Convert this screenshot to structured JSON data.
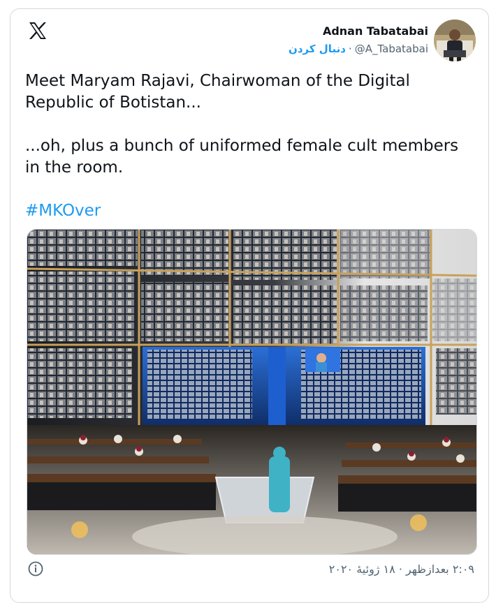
{
  "header": {
    "logo_icon": "x-logo-icon",
    "author_name": "Adnan Tabatabai",
    "follow_label": "دنبال کردن",
    "separator": "·",
    "handle": "@A_Tabatabai"
  },
  "tweet": {
    "line1": "Meet Maryam Rajavi, Chairwoman of the Digital Republic of Botistan...",
    "line2": "...oh, plus a bunch of uniformed female cult members in the room.",
    "hashtag": "#MKOver"
  },
  "footer": {
    "info_icon": "info-icon",
    "timestamp": "۲:۰۹ بعدازظهر · ۱۸ ژوئیهٔ ۲۰۲۰"
  },
  "colors": {
    "link": "#1d9bf0",
    "text": "#0f1419",
    "muted": "#536471",
    "border": "#cfd9de"
  }
}
